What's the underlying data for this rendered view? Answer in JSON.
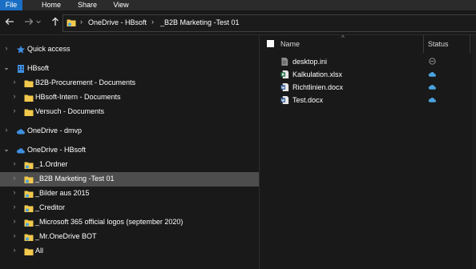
{
  "ribbon": {
    "tabs": [
      "File",
      "Home",
      "Share",
      "View"
    ]
  },
  "address": {
    "crumbs": [
      "OneDrive - HBsoft",
      "_B2B Marketing -Test 01"
    ]
  },
  "tree": [
    {
      "label": "Quick access",
      "icon": "star-icon",
      "expand": "collapsed",
      "indent": 0
    },
    {
      "label": "HBsoft",
      "icon": "building-icon",
      "expand": "expanded",
      "indent": 0
    },
    {
      "label": "B2B-Procurement - Documents",
      "icon": "folder-icon",
      "expand": "collapsed",
      "indent": 1
    },
    {
      "label": "HBsoft-Intern - Documents",
      "icon": "folder-icon",
      "expand": "collapsed",
      "indent": 1
    },
    {
      "label": "Versuch - Documents",
      "icon": "folder-icon",
      "expand": "collapsed",
      "indent": 1
    },
    {
      "label": "OneDrive - dmvp",
      "icon": "cloud-icon",
      "expand": "collapsed",
      "indent": 0
    },
    {
      "label": "OneDrive - HBsoft",
      "icon": "cloud-icon",
      "expand": "expanded",
      "indent": 0
    },
    {
      "label": "_1.Ordner",
      "icon": "shared-folder-icon",
      "expand": "collapsed",
      "indent": 1
    },
    {
      "label": "_B2B Marketing -Test 01",
      "icon": "shared-folder-icon",
      "expand": "collapsed",
      "indent": 1,
      "selected": true
    },
    {
      "label": "_Bilder aus 2015",
      "icon": "shared-folder-icon",
      "expand": "collapsed",
      "indent": 1
    },
    {
      "label": "_Creditor",
      "icon": "shared-folder-icon",
      "expand": "collapsed",
      "indent": 1
    },
    {
      "label": "_Microsoft 365 official logos (september 2020)",
      "icon": "shared-folder-icon",
      "expand": "collapsed",
      "indent": 1
    },
    {
      "label": "_Mr.OneDrive BOT",
      "icon": "shared-folder-icon",
      "expand": "collapsed",
      "indent": 1
    },
    {
      "label": "All",
      "icon": "folder-icon",
      "expand": "collapsed",
      "indent": 1
    }
  ],
  "list": {
    "headers": {
      "name": "Name",
      "status": "Status"
    },
    "files": [
      {
        "name": "desktop.ini",
        "icon": "ini-file-icon",
        "status": "excluded"
      },
      {
        "name": "Kalkulation.xlsx",
        "icon": "excel-file-icon",
        "status": "cloud"
      },
      {
        "name": "Richtlinien.docx",
        "icon": "word-file-icon",
        "status": "cloud"
      },
      {
        "name": "Test.docx",
        "icon": "word-file-icon",
        "status": "cloud"
      }
    ]
  },
  "colors": {
    "accent": "#1a6fc4",
    "background": "#191919",
    "selection": "#4d4d4d",
    "cloud": "#4aa3df"
  }
}
